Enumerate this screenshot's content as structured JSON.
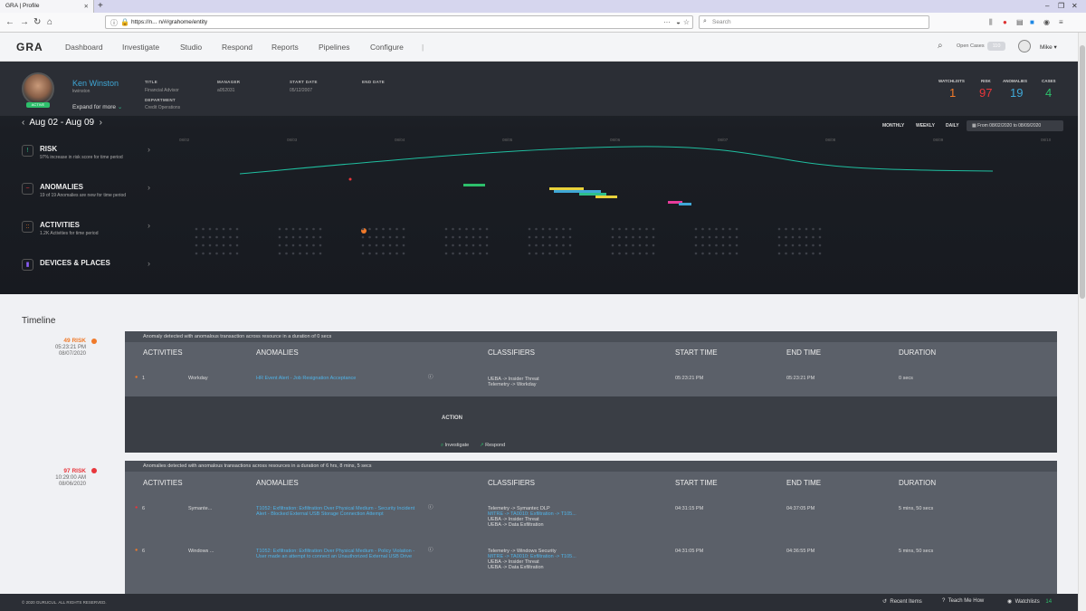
{
  "browser": {
    "tab_title": "GRA | Profile",
    "url": "https://n...                   n/#/grahome/entity",
    "search_placeholder": "Search"
  },
  "app": {
    "logo": "GRA",
    "nav": [
      "Dashboard",
      "Investigate",
      "Studio",
      "Respond",
      "Reports",
      "Pipelines",
      "Configure"
    ],
    "open_cases_label": "Open Cases",
    "open_cases_count": "110",
    "user": "Mike"
  },
  "profile": {
    "name": "Ken Winston",
    "username": "kwinston",
    "status": "ACTIVE",
    "expand_label": "Expand for more",
    "title_label": "TITLE",
    "title_value": "Financial Advisor",
    "department_label": "DEPARTMENT",
    "department_value": "Credit Operations",
    "manager_label": "MANAGER",
    "manager_value": "a052031",
    "start_label": "START DATE",
    "start_value": "05/12/2007",
    "end_label": "END DATE",
    "stats": [
      {
        "label": "WATCHLISTS",
        "value": "1",
        "color": "#f07a2a"
      },
      {
        "label": "RISK",
        "value": "97",
        "color": "#e8363b"
      },
      {
        "label": "ANOMALIES",
        "value": "19",
        "color": "#3fa7d6"
      },
      {
        "label": "CASES",
        "value": "4",
        "color": "#2dbf6b"
      }
    ]
  },
  "range": {
    "label": "Aug 02 - Aug 09",
    "monthly": "MONTHLY",
    "weekly": "WEEKLY",
    "daily": "DAILY",
    "date_box": "From  08/02/2020  to  08/09/2020",
    "axis_dates": [
      "08/02",
      "08/03",
      "08/04",
      "08/05",
      "08/06",
      "08/07",
      "08/08",
      "08/09",
      "08/10"
    ]
  },
  "categories": [
    {
      "title": "RISK",
      "desc": "97% increase in risk score for time period",
      "icon": "!",
      "color": "#2dbf8b"
    },
    {
      "title": "ANOMALIES",
      "desc": "19 of 19 Anomalies are new for time period",
      "icon": "~",
      "color": "#e8363b"
    },
    {
      "title": "ACTIVITIES",
      "desc": "1.2K Activities for time period",
      "icon": "::",
      "color": "#f07a2a"
    },
    {
      "title": "DEVICES & PLACES",
      "desc": "",
      "icon": "▮",
      "color": "#8a5cf5"
    }
  ],
  "timeline": {
    "title": "Timeline",
    "events": [
      {
        "risk": "49 RISK",
        "risk_color": "#f07a2a",
        "time": "05:23:21 PM",
        "date": "08/07/2020",
        "header": "Anomaly detected with  anomalous transaction across  resource in a duration of 0 secs",
        "columns": [
          "ACTIVITIES",
          "ANOMALIES",
          "CLASSIFIERS",
          "START TIME",
          "END TIME",
          "DURATION"
        ],
        "rows": [
          {
            "count": "1",
            "source": "Workday",
            "anomaly": "HR Event Alert - Job Resignation Acceptance",
            "classifiers": [
              "UEBA -> Insider Threat",
              "Telemetry -> Workday"
            ],
            "start": "05:23:21 PM",
            "end": "05:23:21 PM",
            "duration": "0 secs"
          }
        ],
        "action_label": "ACTION",
        "investigate": "Investigate",
        "respond": "Respond"
      },
      {
        "risk": "97 RISK",
        "risk_color": "#e8363b",
        "time": "10:29:00 AM",
        "date": "08/06/2020",
        "header": "Anomalies detected with  anomalous transactions across  resources in a duration of 6 hrs, 8 mins, 5 secs",
        "columns": [
          "ACTIVITIES",
          "ANOMALIES",
          "CLASSIFIERS",
          "START TIME",
          "END TIME",
          "DURATION"
        ],
        "rows": [
          {
            "count": "6",
            "source": "Symante...",
            "anomaly": "T1052: Exfiltration: Exfiltration Over Physical Medium - Security Incident Alert - Blocked External USB Storage Connection Attempt",
            "classifiers": [
              "Telemetry -> Symantec DLP",
              "MITRE -> TA0010: Exfiltration -> T105...",
              "UEBA -> Insider Threat",
              "UEBA -> Data Exfiltration"
            ],
            "start": "04:31:15 PM",
            "end": "04:37:05 PM",
            "duration": "5 mins, 50 secs"
          },
          {
            "count": "6",
            "source": "Windows ...",
            "anomaly": "T1052: Exfiltration: Exfiltration Over Physical Medium - Policy Violation - User made an attempt to connect an Unauthorized External USB Drive",
            "classifiers": [
              "Telemetry -> Windows Security",
              "MITRE -> TA0010: Exfiltration -> T105...",
              "UEBA -> Insider Threat",
              "UEBA -> Data Exfiltration"
            ],
            "start": "04:31:05 PM",
            "end": "04:36:55 PM",
            "duration": "5 mins, 50 secs"
          }
        ]
      }
    ]
  },
  "footer": {
    "copyright": "© 2020 GURUCUL. ALL RIGHTS RESERVED.",
    "recent": "Recent Items",
    "teach": "Teach Me How",
    "watchlists": "Watchlists",
    "watchlists_count": "14"
  }
}
